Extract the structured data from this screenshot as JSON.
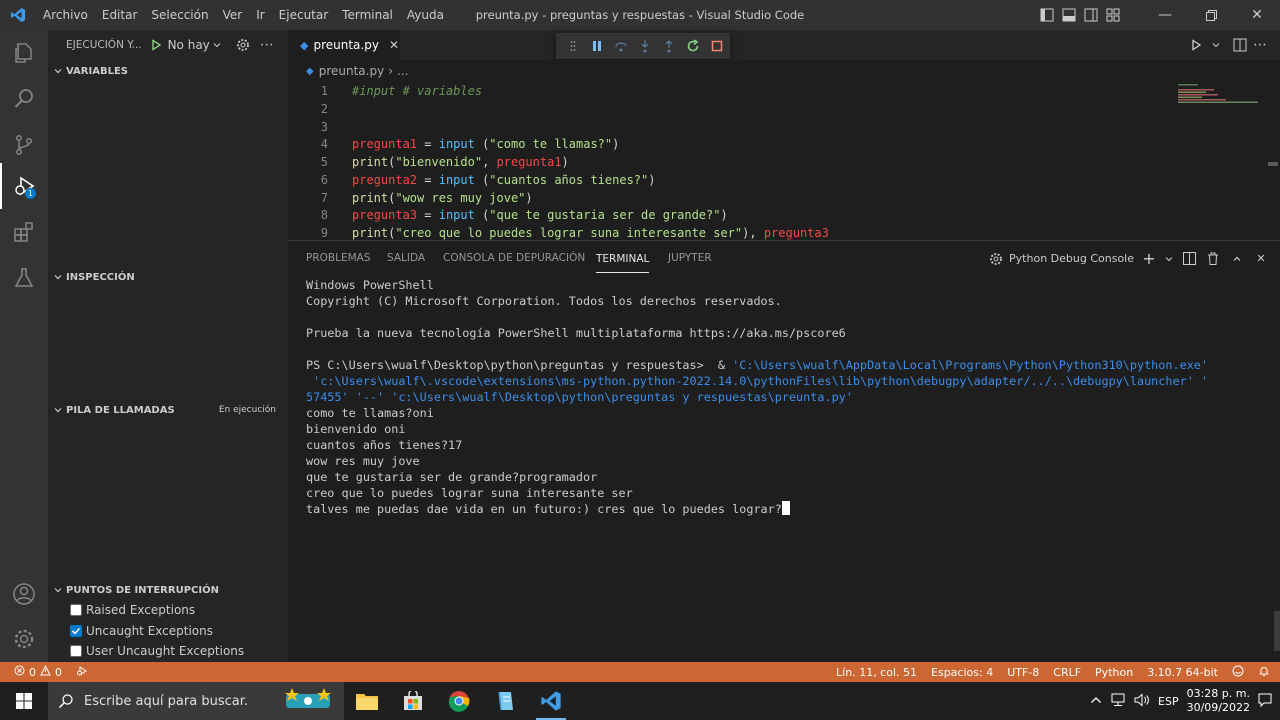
{
  "window": {
    "title": "preunta.py - preguntas y respuestas - Visual Studio Code",
    "menu": [
      "Archivo",
      "Editar",
      "Selección",
      "Ver",
      "Ir",
      "Ejecutar",
      "Terminal",
      "Ayuda"
    ]
  },
  "activity": {
    "debug_badge": "1",
    "icons": [
      "explorer-icon",
      "search-icon",
      "source-control-icon",
      "run-debug-icon",
      "extensions-icon",
      "testing-icon",
      "account-icon",
      "settings-gear-icon"
    ]
  },
  "sidebar": {
    "header": "EJECUCIÓN Y...",
    "run_config": "No hay",
    "sections": {
      "variables": "VARIABLES",
      "inspeccion": "INSPECCIÓN",
      "pila": "PILA DE LLAMADAS",
      "pila_status": "En ejecución",
      "puntos": "PUNTOS DE INTERRUPCIÓN"
    },
    "breakpoints": [
      {
        "label": "Raised Exceptions",
        "checked": false
      },
      {
        "label": "Uncaught Exceptions",
        "checked": true
      },
      {
        "label": "User Uncaught Exceptions",
        "checked": false
      }
    ]
  },
  "editor": {
    "tab": "preunta.py",
    "breadcrumb_file": "preunta.py",
    "breadcrumb_more": "...",
    "line_numbers": [
      "1",
      "2",
      "3",
      "4",
      "5",
      "6",
      "7",
      "8",
      "9"
    ],
    "lines": {
      "l1": "#input # variables",
      "l4a": "pregunta1",
      "l4b": " = ",
      "l4c": "input",
      "l4d": " (",
      "l4e": "\"como te llamas?\"",
      "l4f": ")",
      "l5a": "print",
      "l5b": "(",
      "l5c": "\"bienvenido\"",
      "l5d": ", ",
      "l5e": "pregunta1",
      "l5f": ")",
      "l6a": "pregunta2",
      "l6b": " = ",
      "l6c": "input",
      "l6d": " (",
      "l6e": "\"cuantos años tienes?\"",
      "l6f": ")",
      "l7a": "print",
      "l7b": "(",
      "l7c": "\"wow res muy jove\"",
      "l7d": ")",
      "l8a": "pregunta3",
      "l8b": " = ",
      "l8c": "input",
      "l8d": " (",
      "l8e": "\"que te gustaria ser de grande?\"",
      "l8f": ")",
      "l9a": "print",
      "l9b": "(",
      "l9c": "\"creo que lo puedes lograr suna interesante ser\"",
      "l9d": "), ",
      "l9e": "pregunta3"
    }
  },
  "panel": {
    "tabs": [
      "PROBLEMAS",
      "SALIDA",
      "CONSOLA DE DEPURACIÓN",
      "TERMINAL",
      "JUPYTER"
    ],
    "active_tab": "TERMINAL",
    "terminal_name": "Python Debug Console",
    "terminal": {
      "l1": "Windows PowerShell",
      "l2": "Copyright (C) Microsoft Corporation. Todos los derechos reservados.",
      "l3": "Prueba la nueva tecnología PowerShell multiplataforma https://aka.ms/pscore6",
      "l4a": "PS C:\\Users\\wualf\\Desktop\\python\\preguntas y respuestas>  & ",
      "l4b": "'C:\\Users\\wualf\\AppData\\Local\\Programs\\Python\\Python310\\python.exe'",
      "l5": " 'c:\\Users\\wualf\\.vscode\\extensions\\ms-python.python-2022.14.0\\pythonFiles\\lib\\python\\debugpy\\adapter/../..\\debugpy\\launcher' '",
      "l6": "57455' '--' 'c:\\Users\\wualf\\Desktop\\python\\preguntas y respuestas\\preunta.py'",
      "l7": "como te llamas?oni",
      "l8": "bienvenido oni",
      "l9": "cuantos años tienes?17",
      "l10": "wow res muy jove",
      "l11": "que te gustaria ser de grande?programador",
      "l12": "creo que lo puedes lograr suna interesante ser",
      "l13": "talves me puedas dae vida en un futuro:) cres que lo puedes lograr?"
    }
  },
  "statusbar": {
    "errors": "0",
    "warnings": "0",
    "position": "Lín. 11, col. 51",
    "spaces": "Espacios: 4",
    "encoding": "UTF-8",
    "eol": "CRLF",
    "language": "Python",
    "interpreter": "3.10.7 64-bit"
  },
  "taskbar": {
    "search_placeholder": "Escribe aquí para buscar.",
    "lang": "ESP",
    "time": "03:28 p. m.",
    "date": "30/09/2022"
  },
  "colors": {
    "statusbar": "#cc6633",
    "accent": "#007acc",
    "titlebar": "#323233"
  }
}
